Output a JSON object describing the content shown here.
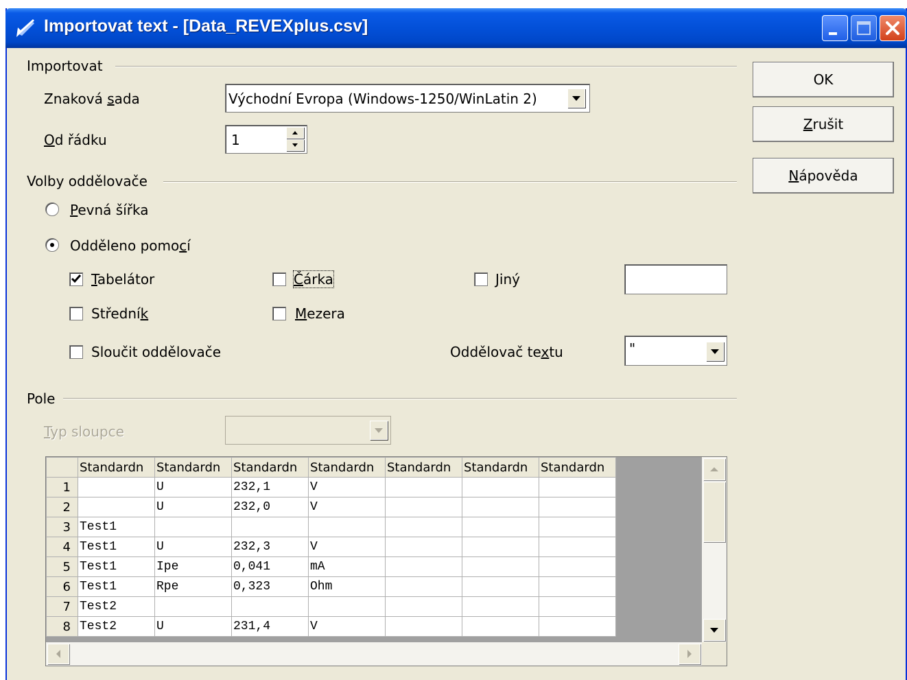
{
  "window": {
    "title": "Importovat text - [Data_REVEXplus.csv]"
  },
  "import_group": {
    "label": "Importovat",
    "charset_label_pre": "Znaková ",
    "charset_label_u": "s",
    "charset_label_post": "ada",
    "charset_value": "Východní Evropa (Windows-1250/WinLatin 2)",
    "fromrow_label_u": "O",
    "fromrow_label_post": "d řádku",
    "fromrow_value": "1"
  },
  "separator_group": {
    "label": "Volby oddělovače",
    "fixed_width_u": "P",
    "fixed_width_post": "evná šířka",
    "separated_pre": "Odděleno pomo",
    "separated_u": "c",
    "separated_post": "í",
    "tab_u": "T",
    "tab_post": "abelátor",
    "comma_u": "Č",
    "comma_post": "árka",
    "other_u": "J",
    "other_post": "iný",
    "other_value": "",
    "semicolon_pre": "Střední",
    "semicolon_u": "k",
    "space_u": "M",
    "space_post": "ezera",
    "merge_pre": "Sloučit",
    "merge_u": "",
    "merge_post": " oddělovače",
    "text_delim_pre": "Oddělovač te",
    "text_delim_u": "x",
    "text_delim_post": "tu",
    "text_delim_value": "\""
  },
  "fields_group": {
    "label": "Pole",
    "column_type_label_u": "T",
    "column_type_label_post": "yp sloupce",
    "column_type_value": "",
    "headers": [
      "Standardn",
      "Standardn",
      "Standardn",
      "Standardn",
      "Standardn",
      "Standardn",
      "Standardn"
    ],
    "rows": [
      {
        "n": "1",
        "c": [
          "",
          "U",
          "232,1",
          "V",
          "",
          "",
          ""
        ]
      },
      {
        "n": "2",
        "c": [
          "",
          "U",
          "232,0",
          "V",
          "",
          "",
          ""
        ]
      },
      {
        "n": "3",
        "c": [
          "Test1",
          "",
          "",
          "",
          "",
          "",
          ""
        ]
      },
      {
        "n": "4",
        "c": [
          "Test1",
          "U",
          "232,3",
          "V",
          "",
          "",
          ""
        ]
      },
      {
        "n": "5",
        "c": [
          "Test1",
          "Ipe",
          "0,041",
          "mA",
          "",
          "",
          ""
        ]
      },
      {
        "n": "6",
        "c": [
          "Test1",
          "Rpe",
          "0,323",
          "Ohm",
          "",
          "",
          ""
        ]
      },
      {
        "n": "7",
        "c": [
          "Test2",
          "",
          "",
          "",
          "",
          "",
          ""
        ]
      },
      {
        "n": "8",
        "c": [
          "Test2",
          "U",
          "231,4",
          "V",
          "",
          "",
          ""
        ]
      }
    ]
  },
  "buttons": {
    "ok": "OK",
    "cancel_u": "Z",
    "cancel_post": "rušit",
    "help_u": "N",
    "help_post": "ápověda"
  },
  "state": {
    "fixed_width_selected": false,
    "separated_selected": true,
    "tab_checked": true,
    "comma_checked": false,
    "other_checked": false,
    "semicolon_checked": false,
    "space_checked": false,
    "merge_checked": false
  }
}
